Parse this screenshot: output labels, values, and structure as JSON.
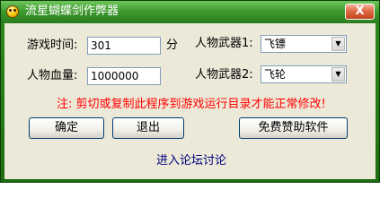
{
  "window": {
    "title": "流星蝴蝶剑作弊器",
    "close_label": "X"
  },
  "form": {
    "game_time_label": "游戏时间:",
    "game_time_value": "301",
    "game_time_unit": "分",
    "hp_label": "人物血量:",
    "hp_value": "1000000",
    "weapon1_label": "人物武器1:",
    "weapon1_value": "飞镖",
    "weapon2_label": "人物武器2:",
    "weapon2_value": "飞轮"
  },
  "warning_text": "注: 剪切或复制此程序到游戏运行目录才能正常修改!",
  "buttons": {
    "ok_label": "确定",
    "exit_label": "退出",
    "sponsor_label": "免费赞助软件"
  },
  "link": {
    "forum_label": "进入论坛讨论"
  },
  "colors": {
    "title_bar": "#3e9b2e",
    "client_bg": "#ece9d8",
    "warning": "#ff0000",
    "link": "#000080"
  }
}
